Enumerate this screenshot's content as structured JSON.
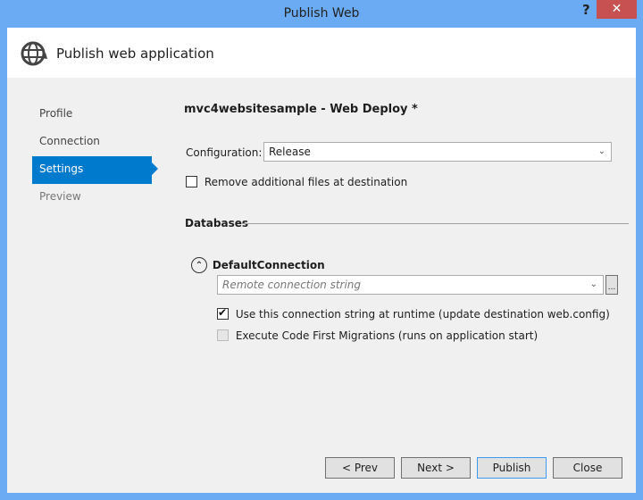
{
  "window": {
    "title": "Publish Web",
    "help_label": "?",
    "close_label": "✕"
  },
  "header": {
    "icon": "globe-publish-icon",
    "title": "Publish web application"
  },
  "nav": {
    "items": [
      {
        "label": "Profile",
        "state": "normal"
      },
      {
        "label": "Connection",
        "state": "normal"
      },
      {
        "label": "Settings",
        "state": "active"
      },
      {
        "label": "Preview",
        "state": "dim"
      }
    ]
  },
  "main": {
    "profile_title": "mvc4websitesample - Web Deploy *",
    "configuration_label": "Configuration:",
    "configuration_value": "Release",
    "remove_files_label": "Remove additional files at destination",
    "remove_files_checked": false,
    "databases_label": "Databases",
    "connection": {
      "name": "DefaultConnection",
      "placeholder": "Remote connection string",
      "browse_label": "...",
      "use_at_runtime_label": "Use this connection string at runtime (update destination web.config)",
      "use_at_runtime_checked": true,
      "migrations_label": "Execute Code First Migrations (runs on application start)",
      "migrations_enabled": false
    }
  },
  "footer": {
    "prev": "< Prev",
    "next": "Next >",
    "publish": "Publish",
    "close": "Close"
  },
  "colors": {
    "frame": "#6aabf4",
    "accent": "#007acc",
    "close": "#c75050"
  }
}
